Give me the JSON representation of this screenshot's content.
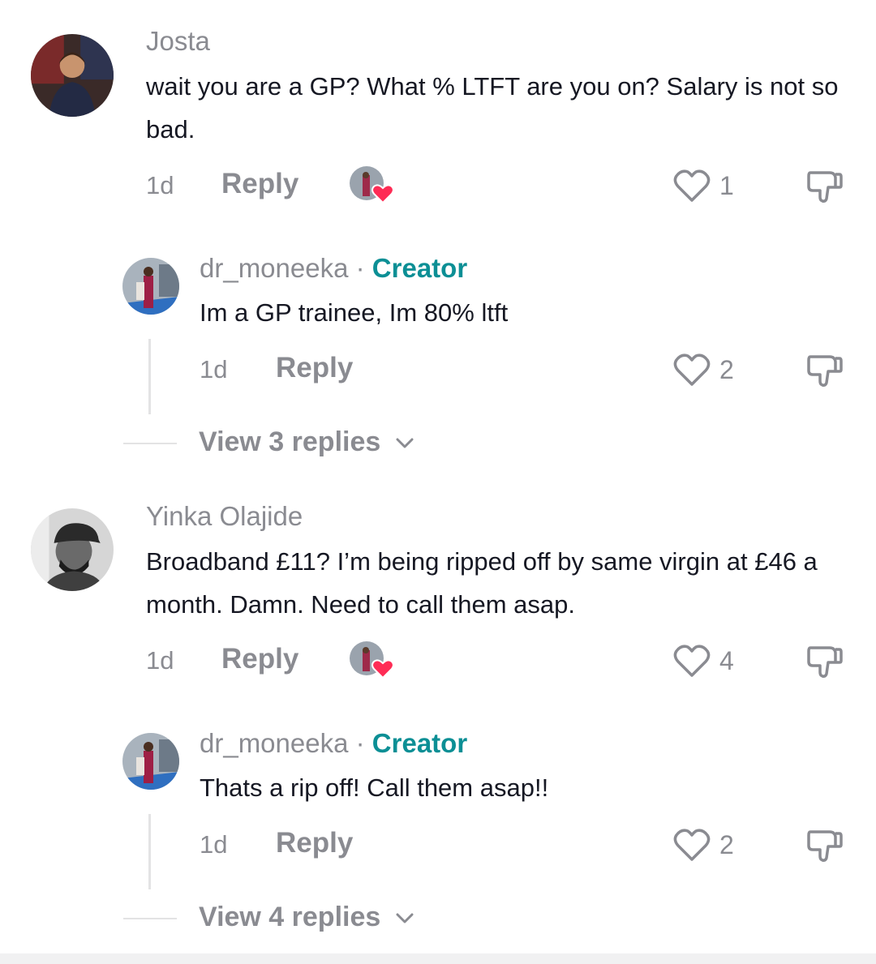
{
  "comments": [
    {
      "username": "Josta",
      "text": "wait you are a GP? What % LTFT are you on? Salary is not so bad.",
      "time": "1d",
      "reply_label": "Reply",
      "likes": "1"
    },
    {
      "username": "dr_moneeka",
      "separator": "·",
      "badge": "Creator",
      "text": "Im a GP trainee, Im 80% ltft",
      "time": "1d",
      "reply_label": "Reply",
      "likes": "2",
      "view_replies": "View 3 replies"
    },
    {
      "username": "Yinka Olajide",
      "text": "Broadband £11? I’m being ripped off by same virgin at £46 a month. Damn. Need to call them asap.",
      "time": "1d",
      "reply_label": "Reply",
      "likes": "4"
    },
    {
      "username": "dr_moneeka",
      "separator": "·",
      "badge": "Creator",
      "text": "Thats a rip off! Call them asap!!",
      "time": "1d",
      "reply_label": "Reply",
      "likes": "2",
      "view_replies": "View 4 replies"
    }
  ],
  "colors": {
    "accent_creator": "#0c8f95",
    "heart_red": "#fe2c55",
    "muted_text": "#8a8b91",
    "primary_text": "#161823"
  },
  "icons": [
    "heart-outline-icon",
    "thumbs-down-icon",
    "chevron-down-icon",
    "creator-liked-heart-icon"
  ]
}
